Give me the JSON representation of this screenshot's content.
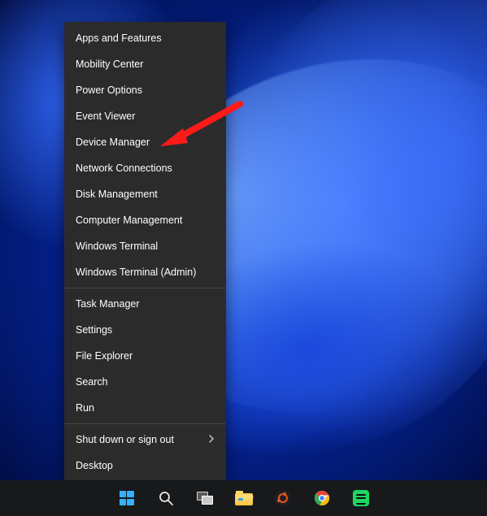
{
  "menu": {
    "sections": [
      [
        "Apps and Features",
        "Mobility Center",
        "Power Options",
        "Event Viewer",
        "Device Manager",
        "Network Connections",
        "Disk Management",
        "Computer Management",
        "Windows Terminal",
        "Windows Terminal (Admin)"
      ],
      [
        "Task Manager",
        "Settings",
        "File Explorer",
        "Search",
        "Run"
      ],
      [
        "Shut down or sign out",
        "Desktop"
      ]
    ],
    "submenu_item": "Shut down or sign out",
    "highlighted": "Device Manager"
  },
  "taskbar": {
    "items": [
      "start",
      "search",
      "task-view",
      "file-explorer",
      "ubuntu",
      "chrome",
      "spotify"
    ]
  },
  "annotation": {
    "type": "arrow",
    "color": "#ff1a1a",
    "target": "Device Manager"
  }
}
